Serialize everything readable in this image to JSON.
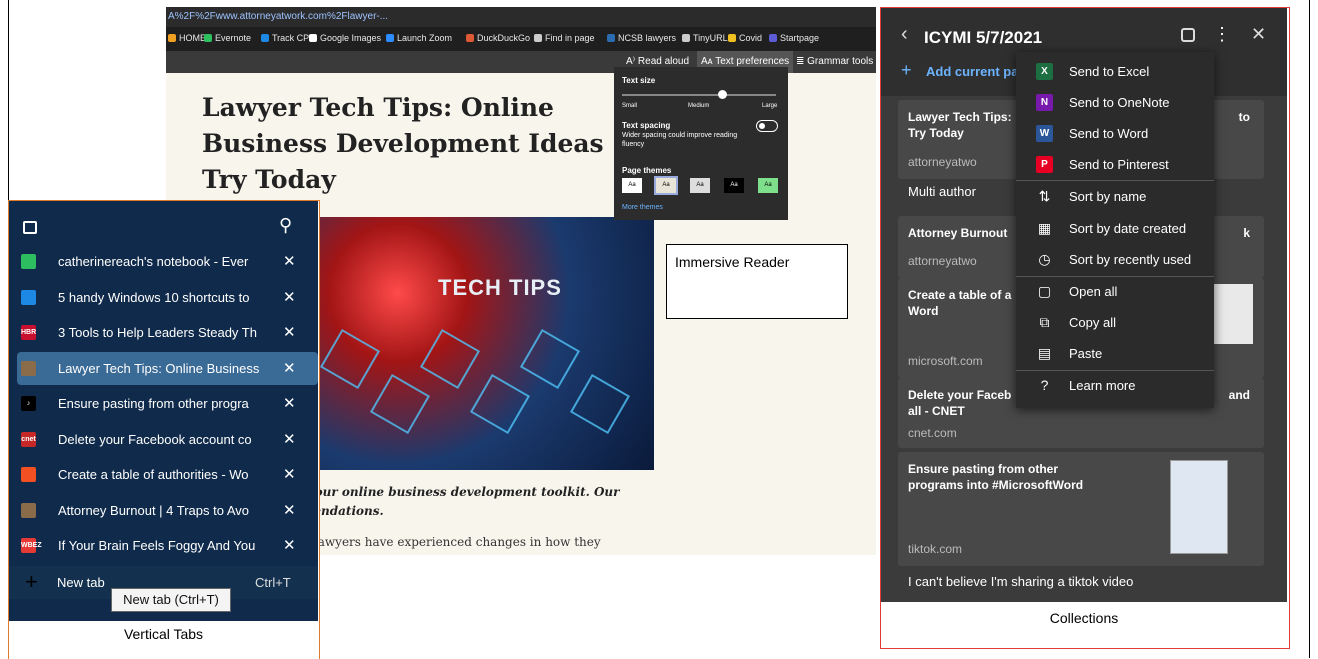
{
  "browser": {
    "address": "A%2F%2Fwww.attorneyatwork.com%2Flawyer-...",
    "favorites": [
      {
        "label": "HOME",
        "color": "#f0a020"
      },
      {
        "label": "Evernote",
        "color": "#2dbe60"
      },
      {
        "label": "Track CPM",
        "color": "#1e88e5"
      },
      {
        "label": "Google Images",
        "color": "#ffffff"
      },
      {
        "label": "Launch Zoom",
        "color": "#2d8cff"
      },
      {
        "label": "DuckDuckGo",
        "color": "#de5833"
      },
      {
        "label": "Find in page",
        "color": "#cccccc"
      },
      {
        "label": "NCSB lawyers",
        "color": "#2b6cb0"
      },
      {
        "label": "TinyURL",
        "color": "#cccccc"
      },
      {
        "label": "Covid",
        "color": "#f0c020"
      },
      {
        "label": "Startpage",
        "color": "#5b5bd6"
      }
    ],
    "reader_toolbar": {
      "read_aloud": "A⁾ Read aloud",
      "text_preferences": "Aᴀ Text preferences",
      "grammar_tools": "≣ Grammar tools"
    },
    "text_prefs": {
      "text_size": "Text size",
      "small": "Small",
      "medium": "Medium",
      "large": "Large",
      "text_spacing": "Text spacing",
      "spacing_desc_1": "Wider spacing could improve reading",
      "spacing_desc_2": "fluency",
      "page_themes": "Page themes",
      "theme_label": "Aa",
      "more_themes": "More themes"
    },
    "article": {
      "title": "Lawyer Tech Tips: Online Business Development Ideas Try Today",
      "hero_text": "TECH TIPS",
      "italic_line1": "sh your online business development toolkit. Our",
      "italic_line2": "mmendations.",
      "body_line1": "nic, lawyers have experienced changes in how they"
    }
  },
  "immersive_label": "Immersive Reader",
  "vertical_tabs": {
    "tabs": [
      {
        "title": "catherinereach's notebook - Ever",
        "icon_color": "#2dbe60"
      },
      {
        "title": "5 handy Windows 10 shortcuts to",
        "icon_color": "#1e88e5"
      },
      {
        "title": "3 Tools to Help Leaders Steady Th",
        "icon_color": "#c8102e",
        "icon_text": "HBR"
      },
      {
        "title": "Lawyer Tech Tips: Online Business",
        "icon_color": "#8a6b4a"
      },
      {
        "title": "Ensure pasting from other progra",
        "icon_color": "#000000",
        "icon_text": "♪"
      },
      {
        "title": "Delete your Facebook account co",
        "icon_color": "#c62828",
        "icon_text": "cnet"
      },
      {
        "title": "Create a table of authorities - Wo",
        "icon_color": "#f25022"
      },
      {
        "title": "Attorney Burnout | 4 Traps to Avo",
        "icon_color": "#8a6b4a"
      },
      {
        "title": "If Your Brain Feels Foggy And You",
        "icon_color": "#e53935",
        "icon_text": "WBEZ"
      }
    ],
    "close_glyph": "✕",
    "new_tab": "New tab",
    "new_tab_shortcut": "Ctrl+T",
    "tooltip": "New tab (Ctrl+T)",
    "caption": "Vertical Tabs"
  },
  "collections": {
    "title": "ICYMI 5/7/2021",
    "add_current": "Add current pa",
    "cards": [
      {
        "title": "Lawyer Tech Tips:",
        "title_tail": "to",
        "line2": "Try Today",
        "source": "attorneyatwo"
      },
      {
        "title": "Attorney Burnout",
        "title_tail": "k",
        "source": "attorneyatwo"
      },
      {
        "title": "Create a table of a",
        "line2": "Word",
        "source": "microsoft.com"
      },
      {
        "title": "Delete your Faceb",
        "title_tail": "and",
        "line2": "all - CNET",
        "source": "cnet.com"
      },
      {
        "title": "Ensure pasting from other",
        "line2": "programs into #MicrosoftWord",
        "source": "tiktok.com"
      }
    ],
    "notes": [
      "Multi author",
      "I can't believe I'm sharing a tiktok video"
    ],
    "caption": "Collections",
    "menu": [
      {
        "label": "Send to Excel",
        "icon": "excel-icon",
        "glyph": "X",
        "color": "#1d6f42"
      },
      {
        "label": "Send to OneNote",
        "icon": "onenote-icon",
        "glyph": "N",
        "color": "#7719aa"
      },
      {
        "label": "Send to Word",
        "icon": "word-icon",
        "glyph": "W",
        "color": "#2b579a"
      },
      {
        "label": "Send to Pinterest",
        "icon": "pinterest-icon",
        "glyph": "P",
        "color": "#e60023"
      },
      {
        "label": "Sort by name",
        "icon": "sort-name-icon",
        "glyph": "⇅"
      },
      {
        "label": "Sort by date created",
        "icon": "calendar-icon",
        "glyph": "▦"
      },
      {
        "label": "Sort by recently used",
        "icon": "clock-icon",
        "glyph": "◷"
      },
      {
        "label": "Open all",
        "icon": "open-all-icon",
        "glyph": "▢"
      },
      {
        "label": "Copy all",
        "icon": "copy-icon",
        "glyph": "⧉"
      },
      {
        "label": "Paste",
        "icon": "paste-icon",
        "glyph": "▤"
      },
      {
        "label": "Learn more",
        "icon": "help-icon",
        "glyph": "?"
      }
    ]
  }
}
